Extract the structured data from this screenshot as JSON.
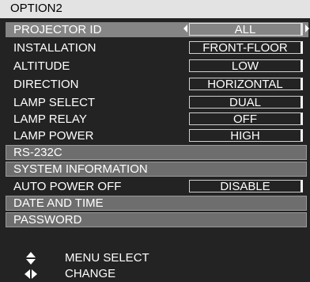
{
  "header": {
    "title": "OPTION2"
  },
  "menu": {
    "projector_id": {
      "label": "PROJECTOR ID",
      "value": "ALL"
    },
    "installation": {
      "label": "INSTALLATION",
      "value": "FRONT-FLOOR"
    },
    "altitude": {
      "label": "ALTITUDE",
      "value": "LOW"
    },
    "direction": {
      "label": "DIRECTION",
      "value": "HORIZONTAL"
    },
    "lamp_select": {
      "label": "LAMP SELECT",
      "value": "DUAL"
    },
    "lamp_relay": {
      "label": "LAMP RELAY",
      "value": "OFF"
    },
    "lamp_power": {
      "label": "LAMP POWER",
      "value": "HIGH"
    },
    "rs232c": {
      "label": "RS-232C"
    },
    "system_information": {
      "label": "SYSTEM INFORMATION"
    },
    "auto_power_off": {
      "label": "AUTO POWER OFF",
      "value": "DISABLE"
    },
    "date_and_time": {
      "label": "DATE AND TIME"
    },
    "password": {
      "label": "PASSWORD"
    }
  },
  "help": {
    "menu_select": {
      "icon": "up-down-arrows-icon",
      "text": "MENU SELECT"
    },
    "change": {
      "icon": "left-right-arrows-icon",
      "text": "CHANGE"
    }
  },
  "colors": {
    "background": "#232323",
    "selected_row": "#858585",
    "button": "#6e6e6e",
    "title_bar": "#e3e3e3"
  }
}
